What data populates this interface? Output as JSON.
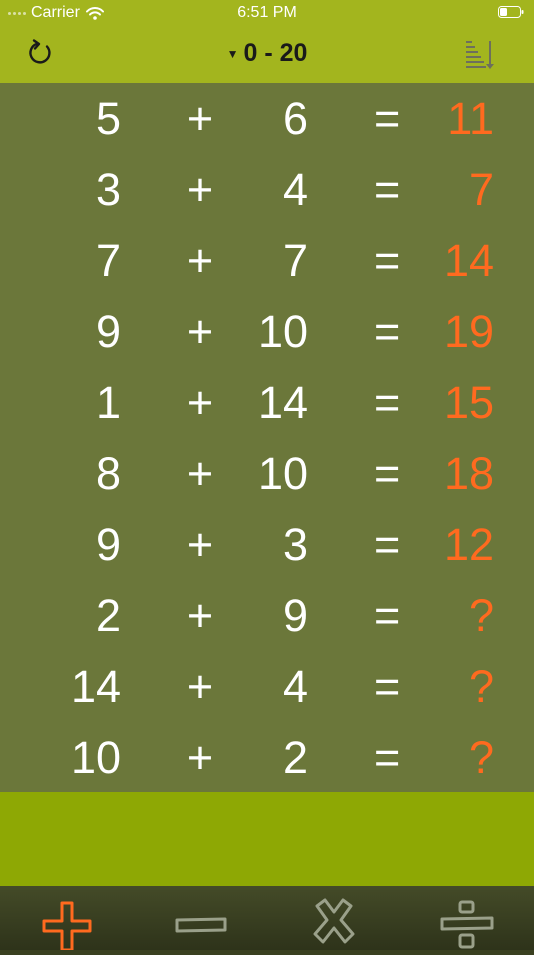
{
  "status_bar": {
    "carrier": "Carrier",
    "time": "6:51 PM",
    "icons": [
      "signal-dots-icon",
      "wifi-icon",
      "battery-icon"
    ]
  },
  "nav": {
    "refresh_icon": "refresh-icon",
    "range_label": "0 - 20",
    "range_indicator": "▼",
    "sort_icon": "sort-icon"
  },
  "problems": [
    {
      "a": "5",
      "op": "+",
      "b": "6",
      "eq": "=",
      "answer": "11"
    },
    {
      "a": "3",
      "op": "+",
      "b": "4",
      "eq": "=",
      "answer": "7"
    },
    {
      "a": "7",
      "op": "+",
      "b": "7",
      "eq": "=",
      "answer": "14"
    },
    {
      "a": "9",
      "op": "+",
      "b": "10",
      "eq": "=",
      "answer": "19"
    },
    {
      "a": "1",
      "op": "+",
      "b": "14",
      "eq": "=",
      "answer": "15"
    },
    {
      "a": "8",
      "op": "+",
      "b": "10",
      "eq": "=",
      "answer": "18"
    },
    {
      "a": "9",
      "op": "+",
      "b": "3",
      "eq": "=",
      "answer": "12"
    },
    {
      "a": "2",
      "op": "+",
      "b": "9",
      "eq": "=",
      "answer": "?"
    },
    {
      "a": "14",
      "op": "+",
      "b": "4",
      "eq": "=",
      "answer": "?"
    },
    {
      "a": "10",
      "op": "+",
      "b": "2",
      "eq": "=",
      "answer": "?"
    }
  ],
  "tabs": [
    {
      "icon": "plus-icon",
      "selected": true
    },
    {
      "icon": "minus-icon",
      "selected": false
    },
    {
      "icon": "multiply-icon",
      "selected": false
    },
    {
      "icon": "divide-icon",
      "selected": false
    }
  ],
  "colors": {
    "bar": "#a3b51e",
    "panel": "#6b773a",
    "band": "#8ea804",
    "answer": "#ff6a1f",
    "tab_selected": "#ff6a1f",
    "tab_unselected": "#9aa08a"
  }
}
